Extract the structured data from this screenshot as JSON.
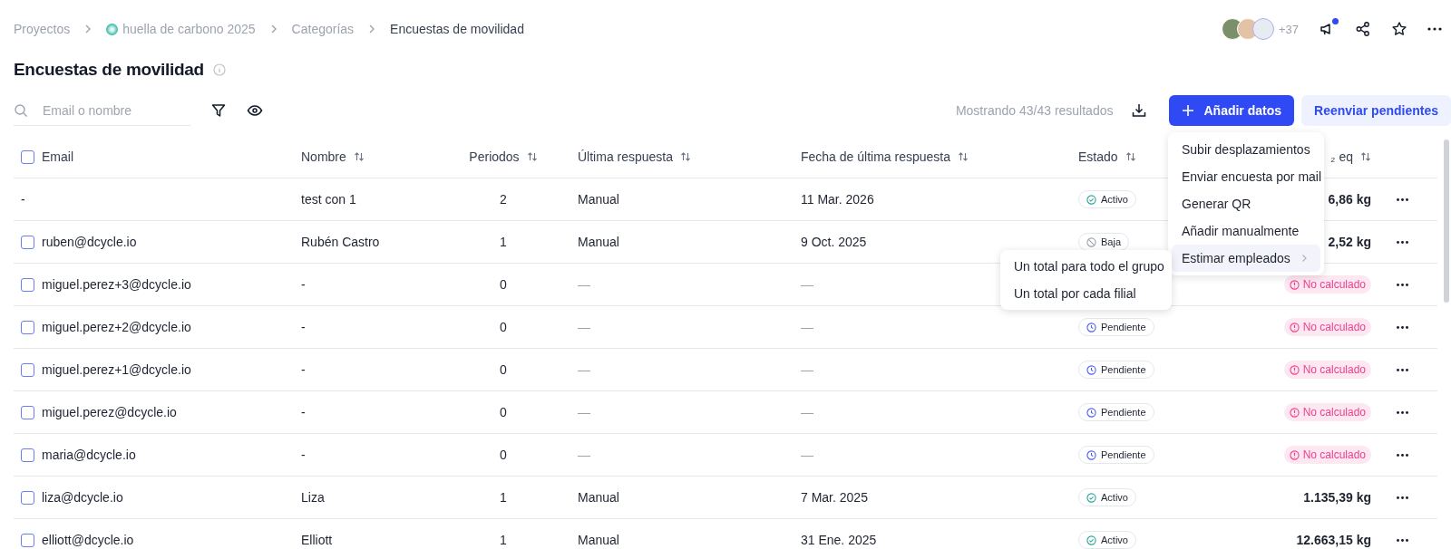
{
  "breadcrumb": [
    {
      "label": "Proyectos",
      "kind": "link"
    },
    {
      "label": "huella de carbono 2025",
      "kind": "project"
    },
    {
      "label": "Categorías",
      "kind": "link"
    },
    {
      "label": "Encuestas de movilidad",
      "kind": "current"
    }
  ],
  "header": {
    "avatars_more": "+37",
    "notification": true
  },
  "title": "Encuestas de movilidad",
  "search": {
    "placeholder": "Email o nombre"
  },
  "results": "Mostrando 43/43 resultados",
  "buttons": {
    "primary": "Añadir datos",
    "secondary": "Reenviar pendientes"
  },
  "table": {
    "header_checked": false,
    "columns": [
      {
        "label": "Email",
        "sortable": false
      },
      {
        "label": "Nombre",
        "sortable": true
      },
      {
        "label": "Periodos",
        "sortable": true
      },
      {
        "label": "Última respuesta",
        "sortable": true
      },
      {
        "label": "Fecha de última respuesta",
        "sortable": true
      },
      {
        "label": "Estado",
        "sortable": true
      },
      {
        "label": "₂ eq",
        "sortable": true
      }
    ],
    "rows": [
      {
        "email": "-",
        "name": "test con 1",
        "periods": "2",
        "last": "Manual",
        "date": "11 Mar. 2026",
        "status": {
          "kind": "active",
          "label": "Activo"
        },
        "total": {
          "kind": "value",
          "label": "6,86 kg"
        }
      },
      {
        "checked": false,
        "email": "ruben@dcycle.io",
        "name": "Rubén Castro",
        "periods": "1",
        "last": "Manual",
        "date": "9 Oct. 2025",
        "status": {
          "kind": "inactive",
          "label": "Baja"
        },
        "total": {
          "kind": "value",
          "label": "2,52 kg"
        }
      },
      {
        "checked": false,
        "email": "miguel.perez+3@dcycle.io",
        "name": "-",
        "periods": "0",
        "last": "—",
        "date": "—",
        "status": {
          "kind": "hidden"
        },
        "total": {
          "kind": "not_calculated",
          "label": "No calculado"
        }
      },
      {
        "checked": false,
        "email": "miguel.perez+2@dcycle.io",
        "name": "-",
        "periods": "0",
        "last": "—",
        "date": "—",
        "status": {
          "kind": "pending",
          "label": "Pendiente"
        },
        "total": {
          "kind": "not_calculated",
          "label": "No calculado"
        }
      },
      {
        "checked": false,
        "email": "miguel.perez+1@dcycle.io",
        "name": "-",
        "periods": "0",
        "last": "—",
        "date": "—",
        "status": {
          "kind": "pending",
          "label": "Pendiente"
        },
        "total": {
          "kind": "not_calculated",
          "label": "No calculado"
        }
      },
      {
        "checked": false,
        "email": "miguel.perez@dcycle.io",
        "name": "-",
        "periods": "0",
        "last": "—",
        "date": "—",
        "status": {
          "kind": "pending",
          "label": "Pendiente"
        },
        "total": {
          "kind": "not_calculated",
          "label": "No calculado"
        }
      },
      {
        "checked": false,
        "email": "maria@dcycle.io",
        "name": "-",
        "periods": "0",
        "last": "—",
        "date": "—",
        "status": {
          "kind": "pending",
          "label": "Pendiente"
        },
        "total": {
          "kind": "not_calculated",
          "label": "No calculado"
        }
      },
      {
        "checked": false,
        "email": "liza@dcycle.io",
        "name": "Liza",
        "periods": "1",
        "last": "Manual",
        "date": "7 Mar. 2025",
        "status": {
          "kind": "active",
          "label": "Activo"
        },
        "total": {
          "kind": "value",
          "label": "1.135,39 kg"
        }
      },
      {
        "checked": false,
        "email": "elliott@dcycle.io",
        "name": "Elliott",
        "periods": "1",
        "last": "Manual",
        "date": "31 Ene. 2025",
        "status": {
          "kind": "active",
          "label": "Activo"
        },
        "total": {
          "kind": "value",
          "label": "12.663,15 kg"
        }
      }
    ]
  },
  "menu": {
    "items": [
      {
        "label": "Subir desplazamientos",
        "has_submenu": false,
        "expanded": false
      },
      {
        "label": "Enviar encuesta por mail",
        "has_submenu": false,
        "expanded": false
      },
      {
        "label": "Generar QR",
        "has_submenu": false,
        "expanded": false
      },
      {
        "label": "Añadir manualmente",
        "has_submenu": false,
        "expanded": false
      },
      {
        "label": "Estimar empleados",
        "has_submenu": true,
        "expanded": true,
        "children": [
          {
            "label": "Un total para todo el grupo"
          },
          {
            "label": "Un total por cada filial"
          }
        ]
      }
    ]
  }
}
